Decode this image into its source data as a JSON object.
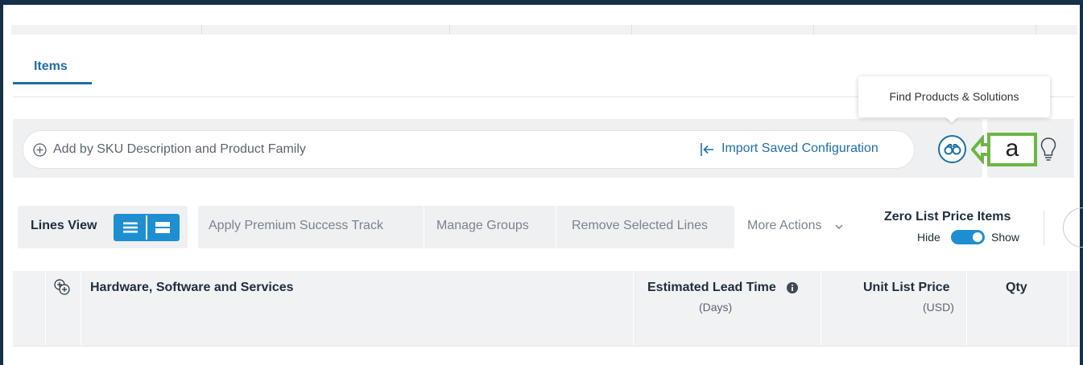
{
  "tabs": {
    "items_label": "Items"
  },
  "tooltip": {
    "text": "Find Products & Solutions"
  },
  "search": {
    "placeholder": "Add by SKU Description and Product Family",
    "import_label": "Import Saved Configuration"
  },
  "callout": {
    "label": "a",
    "color": "#6cb644"
  },
  "toolbar": {
    "lines_view_label": "Lines View",
    "actions": [
      "Apply Premium Success Track",
      "Manage Groups",
      "Remove Selected Lines"
    ],
    "more_actions_label": "More Actions",
    "zero_list_price_title": "Zero List Price Items",
    "hide_label": "Hide",
    "show_label": "Show",
    "zero_list_price_show": true
  },
  "table": {
    "columns": {
      "hardware": "Hardware, Software and Services",
      "lead_time": "Estimated Lead Time",
      "lead_time_unit": "(Days)",
      "unit_price": "Unit List Price",
      "unit_price_unit": "(USD)",
      "qty": "Qty"
    }
  },
  "colors": {
    "accent": "#1d6fa5",
    "toggle": "#1d8fd1",
    "frame": "#16304a"
  },
  "icons": {
    "add": "plus-circle-icon",
    "import": "import-arrow-icon",
    "find": "binoculars-icon",
    "tips": "lightbulb-icon",
    "list_view": "list-view-icon",
    "grouped_view": "grouped-view-icon",
    "more": "chevron-down-icon",
    "info": "info-icon",
    "expand_all": "expand-all-icon"
  }
}
